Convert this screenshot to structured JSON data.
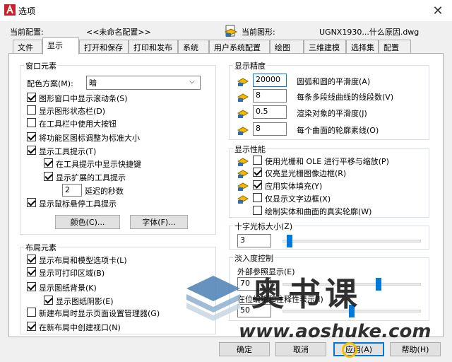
{
  "window": {
    "title": "选项",
    "close_glyph": "✕"
  },
  "header": {
    "current_config_label": "当前配置:",
    "current_config_value": "<<未命名配置>>",
    "current_drawing_label": "当前图形:",
    "current_drawing_value": "UGNX1930...什么原因.dwg"
  },
  "tabs": [
    "文件",
    "显示",
    "打开和保存",
    "打印和发布",
    "系统",
    "用户系统配置",
    "绘图",
    "三维建模",
    "选择集",
    "配置"
  ],
  "active_tab": "显示",
  "window_elements": {
    "title": "窗口元素",
    "color_scheme_label": "配色方案(M):",
    "color_scheme_value": "暗",
    "checkboxes": [
      {
        "label": "图形窗口中显示滚动条(S)",
        "checked": true
      },
      {
        "label": "显示图形状态栏(D)",
        "checked": false
      },
      {
        "label": "在工具栏中使用大按钮",
        "checked": false
      },
      {
        "label": "将功能区图标调整为标准大小",
        "checked": true
      },
      {
        "label": "显示工具提示(T)",
        "checked": true
      },
      {
        "label": "在工具提示中显示快捷键",
        "checked": true
      },
      {
        "label": "显示扩展的工具提示",
        "checked": true
      }
    ],
    "delay_value": "2",
    "delay_label": "延迟的秒数",
    "rollover_tooltip_label": "显示鼠标悬停工具提示",
    "rollover_tooltip_checked": true,
    "colors_button": "颜色(C)...",
    "fonts_button": "字体(F)..."
  },
  "layout_elements": {
    "title": "布局元素",
    "checkboxes": [
      {
        "label": "显示布局和模型选项卡(L)",
        "checked": true
      },
      {
        "label": "显示可打印区域(B)",
        "checked": true
      },
      {
        "label": "显示图纸背景(K)",
        "checked": true
      },
      {
        "label": "显示图纸阴影(E)",
        "checked": true
      },
      {
        "label": "新建布局时显示页面设置管理器(G)",
        "checked": false
      },
      {
        "label": "在新布局中创建视口(N)",
        "checked": true
      }
    ]
  },
  "display_resolution": {
    "title": "显示精度",
    "rows": [
      {
        "value": "20000",
        "label": "圆弧和圆的平滑度(A)"
      },
      {
        "value": "8",
        "label": "每条多段线曲线的线段数(V)"
      },
      {
        "value": "0.5",
        "label": "渲染对象的平滑度(J)"
      },
      {
        "value": "8",
        "label": "每个曲面的轮廓素线(O)"
      }
    ]
  },
  "display_performance": {
    "title": "显示性能",
    "checkboxes": [
      {
        "label": "使用光栅和 OLE 进行平移与缩放(P)",
        "checked": false,
        "bulb": true
      },
      {
        "label": "仅亮显光栅图像边框(R)",
        "checked": true,
        "bulb": true
      },
      {
        "label": "应用实体填充(Y)",
        "checked": true,
        "bulb": true
      },
      {
        "label": "仅显示文字边框(X)",
        "checked": false,
        "bulb": true
      },
      {
        "label": "绘制实体和曲面的真实轮廓(W)",
        "checked": false,
        "bulb": false
      }
    ]
  },
  "crosshair": {
    "title": "十字光标大小(Z)",
    "value": "3",
    "level_percent": 3
  },
  "fade": {
    "title": "淡入度控制",
    "xref_label": "外部参照显示(E)",
    "xref_value": "70",
    "xref_level_percent": 70,
    "inplace_label": "在位编辑和注释性表示(I)",
    "inplace_value": "50",
    "inplace_level_percent": 50
  },
  "buttons": {
    "ok": "确定",
    "cancel": "取消",
    "apply": "应用(A)",
    "help": "帮助(H)"
  },
  "watermark": {
    "brand": "奥书课",
    "url": "www.aoshuke.com"
  },
  "colors": {
    "accent": "#0078d7",
    "slider": "#007ad9",
    "title_icon": "#c8202c"
  }
}
